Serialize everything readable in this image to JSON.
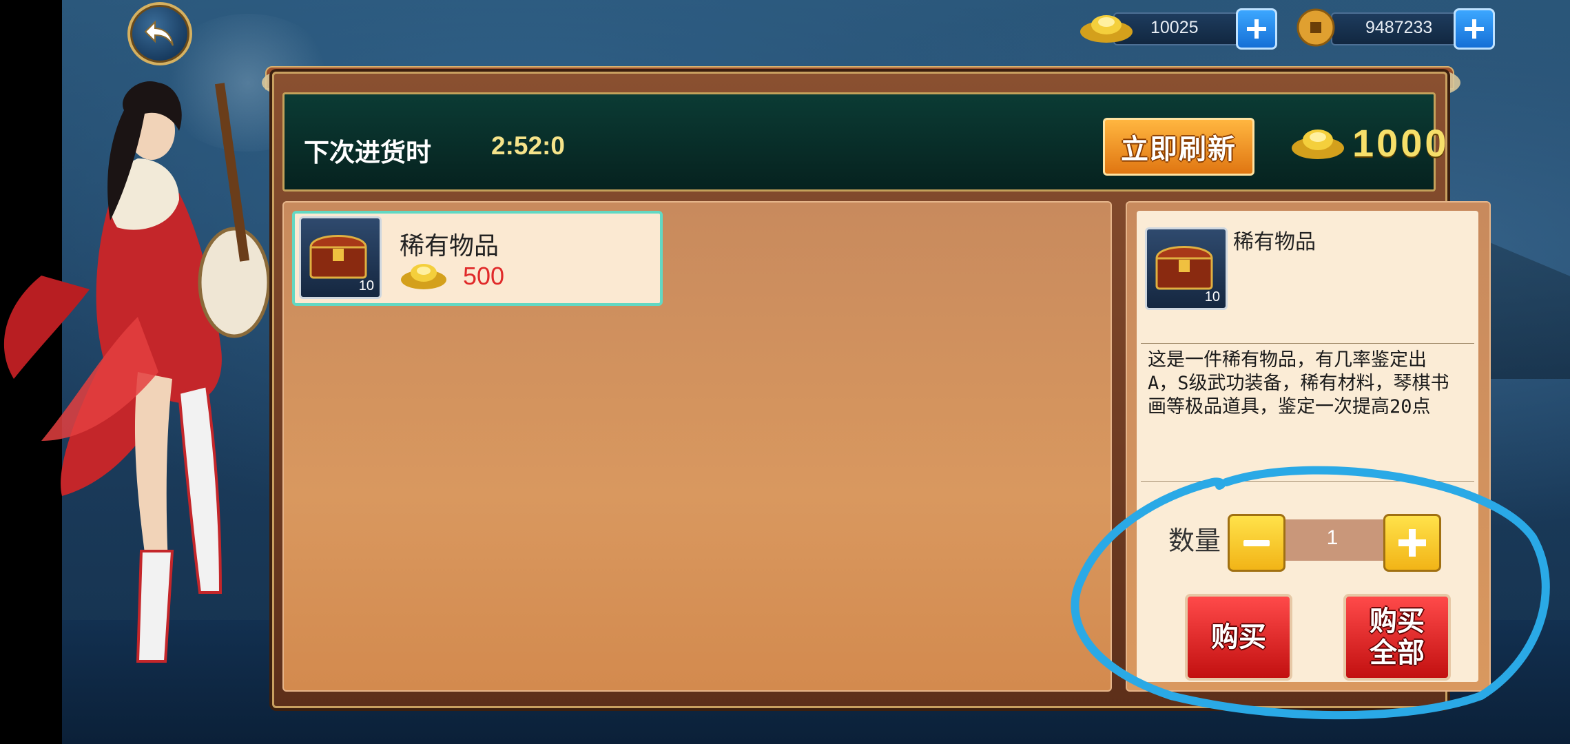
{
  "currencies": {
    "gold_ingot": {
      "icon": "gold-ingot-icon",
      "value": "10025"
    },
    "coin": {
      "icon": "copper-coin-icon",
      "value": "9487233"
    }
  },
  "shop": {
    "restock_label": "下次进货时",
    "restock_timer": "2:52:0",
    "refresh_label": "立即刷新",
    "refresh_cost": "1000"
  },
  "items": [
    {
      "name": "稀有物品",
      "stack": "10",
      "price": "500",
      "price_icon": "gold-ingot-icon"
    }
  ],
  "detail": {
    "name": "稀有物品",
    "stack": "10",
    "description_lines": [
      "这是一件稀有物品，有几率鉴定出",
      "A，S级武功装备，稀有材料，琴棋书",
      "画等极品道具，鉴定一次提高20点"
    ],
    "quantity_label": "数量",
    "quantity": "1",
    "buy_label": "购买",
    "buy_all_label_line1": "购买",
    "buy_all_label_line2": "全部"
  },
  "colors": {
    "annotation_circle": "#2aa9e6",
    "item_border": "#62d8c3",
    "price_red": "#e02a2a"
  }
}
